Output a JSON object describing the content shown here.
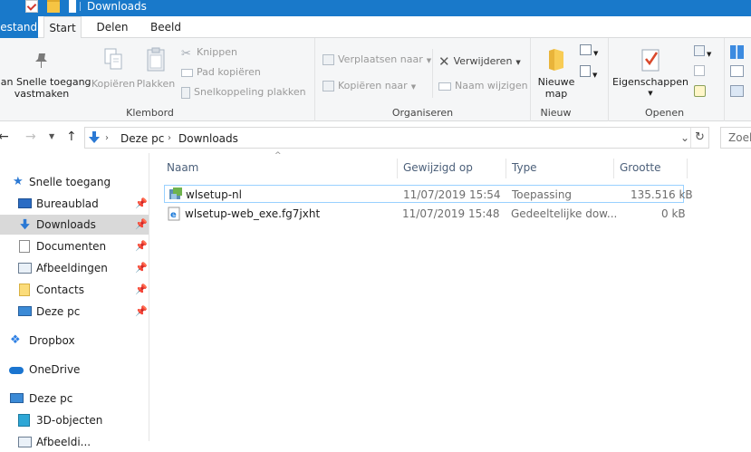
{
  "window": {
    "title": "Downloads"
  },
  "tabs": {
    "file": "Bestand",
    "start": "Start",
    "share": "Delen",
    "view": "Beeld"
  },
  "ribbon": {
    "clipboard": {
      "label": "Klembord",
      "pin_line1": "aan Snelle toegang",
      "pin_line2": "vastmaken",
      "copy": "Kopiëren",
      "paste": "Plakken",
      "cut": "Knippen",
      "copy_path": "Pad kopiëren",
      "paste_shortcut": "Snelkoppeling plakken"
    },
    "organize": {
      "label": "Organiseren",
      "move_to": "Verplaatsen naar",
      "copy_to": "Kopiëren naar",
      "delete": "Verwijderen",
      "rename": "Naam wijzigen"
    },
    "new": {
      "label": "Nieuw",
      "new_folder_line1": "Nieuwe",
      "new_folder_line2": "map"
    },
    "open": {
      "label": "Openen",
      "properties": "Eigenschappen"
    }
  },
  "address": {
    "crumbs": [
      "Deze pc",
      "Downloads"
    ],
    "search_placeholder": "Zoek"
  },
  "nav": {
    "items": [
      {
        "label": "Snelle toegang"
      },
      {
        "label": "Bureaublad"
      },
      {
        "label": "Downloads"
      },
      {
        "label": "Documenten"
      },
      {
        "label": "Afbeeldingen"
      },
      {
        "label": "Contacts"
      },
      {
        "label": "Deze pc"
      },
      {
        "label": "Dropbox"
      },
      {
        "label": "OneDrive"
      },
      {
        "label": "Deze pc"
      },
      {
        "label": "3D-objecten"
      },
      {
        "label": "Afbeeldi..."
      }
    ]
  },
  "columns": {
    "name": "Naam",
    "modified": "Gewijzigd op",
    "type": "Type",
    "size": "Grootte"
  },
  "files": [
    {
      "name": "wlsetup-nl",
      "modified": "11/07/2019 15:54",
      "type": "Toepassing",
      "size": "135.516 kB"
    },
    {
      "name": "wlsetup-web_exe.fg7jxht",
      "modified": "11/07/2019 15:48",
      "type": "Gedeeltelijke dow...",
      "size": "0 kB"
    }
  ],
  "colors": {
    "accent": "#1979ca",
    "selected_nav": "#d9d9d9",
    "selected_row_border": "#99d1ff"
  }
}
